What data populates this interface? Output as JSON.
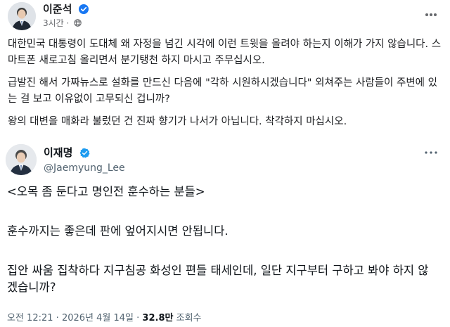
{
  "post": {
    "author_name": "이준석",
    "timestamp": "3시간",
    "meta_separator": "·",
    "paragraphs": [
      "대한민국 대통령이 도대체 왜 자정을 넘긴 시각에 이런 트윗을 올려야 하는지 이해가 가지 않습니다. 스마트폰 새로고침 올리면서 분기탱천 하지 마시고 주무십시오.",
      "급발진 해서 가짜뉴스로 설화를 만드신 다음에 \"각하 시원하시겠습니다\" 외쳐주는 사람들이 주변에 있는 걸 보고 이유없이 고무되신 겁니까?",
      "왕의 대변을 매화라 불렀던 건 진짜 향기가 나서가 아닙니다. 착각하지 마십시오."
    ]
  },
  "tweet": {
    "name": "이재명",
    "handle": "@Jaemyung_Lee",
    "lines": [
      "<오목 좀 둔다고 명인전 훈수하는 분들>",
      "훈수까지는 좋은데 판에 엎어지시면 안됩니다.",
      "집안 싸움 집착하다 지구침공 화성인 편들 태세인데, 일단 지구부터 구하고 봐야 하지 않겠습니까?"
    ],
    "time": "오전 12:21",
    "date": "2026년 4월 14일",
    "views_count": "32.8만",
    "views_label": "조회수",
    "separator": "·"
  },
  "colors": {
    "verified_fb": "#1877f2",
    "verified_x": "#1d9bf0",
    "text_primary": "#1c1e21",
    "text_secondary": "#65676b"
  },
  "icons": [
    "verified-badge-icon",
    "globe-icon",
    "more-options-icon",
    "x-verified-badge-icon",
    "x-more-options-icon"
  ]
}
